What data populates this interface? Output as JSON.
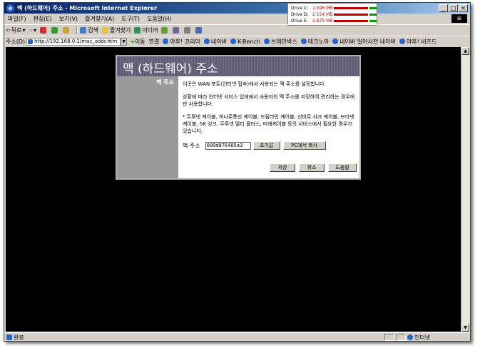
{
  "window": {
    "title": "맥 (하드웨어) 주소 - Microsoft Internet Explorer",
    "btn_min": "_",
    "btn_max": "□",
    "btn_close": "×"
  },
  "drives": [
    {
      "name": "Drive C:",
      "value": "1.046 MB"
    },
    {
      "name": "Drive D:",
      "value": "2.154 MB"
    },
    {
      "name": "Drive E:",
      "value": "2.675 MB"
    }
  ],
  "menu": [
    "파일(F)",
    "편집(E)",
    "보기(V)",
    "즐겨찾기(A)",
    "도구(T)",
    "도움말(H)"
  ],
  "toolbar": {
    "back": "뒤로",
    "search": "검색",
    "favorites": "즐겨찾기",
    "media": "미디어"
  },
  "address": {
    "label": "주소(D)",
    "url": "http://192.168.0.1/mac_addr.htm",
    "go": "이동",
    "links_label": "연결"
  },
  "links": [
    "야후! 코리아",
    "네이버",
    "K-Bench",
    "브레인박스",
    "테크노아",
    "네이버 일어사전 네이버",
    "야후! 비즈드"
  ],
  "dialog": {
    "title": "맥 (하드웨어) 주소",
    "side_label": "맥 주소",
    "paragraphs": [
      "이곳은 WAN 포트(인터넷 접속)에서 사용되는 맥 주소를 설정합니다.",
      "상황에 따라 인터넷 서비스 업체에서 사용자의 맥 주소를 저장하여 관리하는 경우에만 사용합니다.",
      "* 두루넷 케이블, 하나로통신 케이블, 드림라인 케이블, 신비로 샤크 케이블, 브라넷 케이블, SK 싱크, 두루넷 멀티 플러스, 미래케이블 등의 서비스에서 필요한 경우가 있습니다."
    ],
    "mac_label": "맥 주소",
    "mac_value": "000d876405a3",
    "reset_button": "초기값",
    "copy_pc_button": "PC에서 복사",
    "save_button": "저장",
    "cancel_button": "취소",
    "help_button": "도움말"
  },
  "status": {
    "text": "완료",
    "zone": "인터넷"
  }
}
